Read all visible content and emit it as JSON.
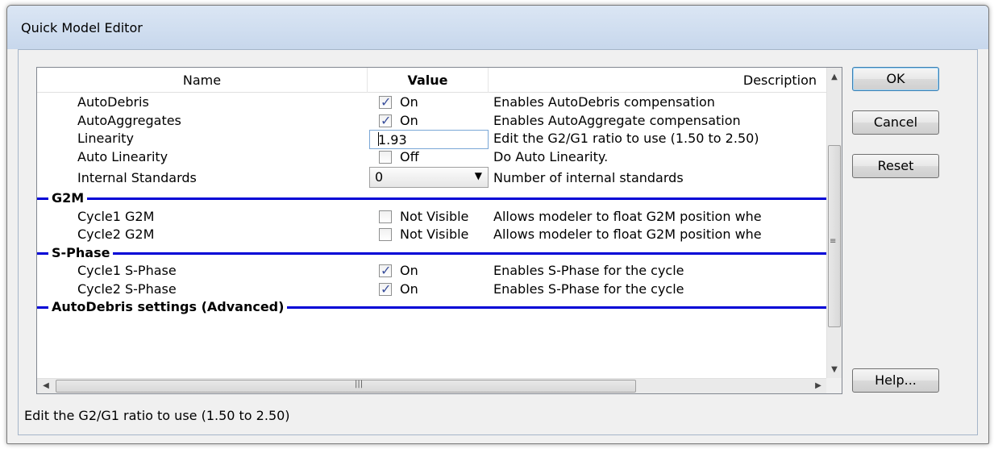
{
  "window": {
    "title": "Quick Model Editor"
  },
  "grid": {
    "columns": {
      "name": "Name",
      "value": "Value",
      "description": "Description"
    },
    "rows": [
      {
        "kind": "checkbox",
        "name": "AutoDebris",
        "checked": true,
        "value": "On",
        "description": "Enables AutoDebris compensation"
      },
      {
        "kind": "checkbox",
        "name": "AutoAggregates",
        "checked": true,
        "value": "On",
        "description": "Enables AutoAggregate compensation"
      },
      {
        "kind": "text",
        "name": "Linearity",
        "value": "1.93",
        "description": "Edit the G2/G1 ratio to use (1.50 to 2.50)"
      },
      {
        "kind": "checkbox",
        "name": "Auto Linearity",
        "checked": false,
        "value": "Off",
        "description": "Do Auto Linearity."
      },
      {
        "kind": "combo",
        "name": "Internal Standards",
        "value": "0",
        "description": "Number of internal standards"
      },
      {
        "kind": "section",
        "name": "G2M"
      },
      {
        "kind": "checkbox",
        "name": "Cycle1 G2M",
        "checked": false,
        "value": "Not Visible",
        "description": "Allows modeler to float G2M position whe"
      },
      {
        "kind": "checkbox",
        "name": "Cycle2 G2M",
        "checked": false,
        "value": "Not Visible",
        "description": "Allows modeler to float G2M position whe"
      },
      {
        "kind": "section",
        "name": "S-Phase"
      },
      {
        "kind": "checkbox",
        "name": "Cycle1 S-Phase",
        "checked": true,
        "value": "On",
        "description": "Enables S-Phase for the cycle"
      },
      {
        "kind": "checkbox",
        "name": "Cycle2 S-Phase",
        "checked": true,
        "value": "On",
        "description": "Enables S-Phase for the cycle"
      },
      {
        "kind": "section",
        "name": "AutoDebris settings (Advanced)"
      }
    ]
  },
  "buttons": {
    "ok": "OK",
    "cancel": "Cancel",
    "reset": "Reset",
    "help": "Help..."
  },
  "status": {
    "text": "Edit the G2/G1 ratio to use (1.50 to 2.50)"
  },
  "colors": {
    "section_line": "#0000d6",
    "title_bar": "#c7d7ec"
  }
}
